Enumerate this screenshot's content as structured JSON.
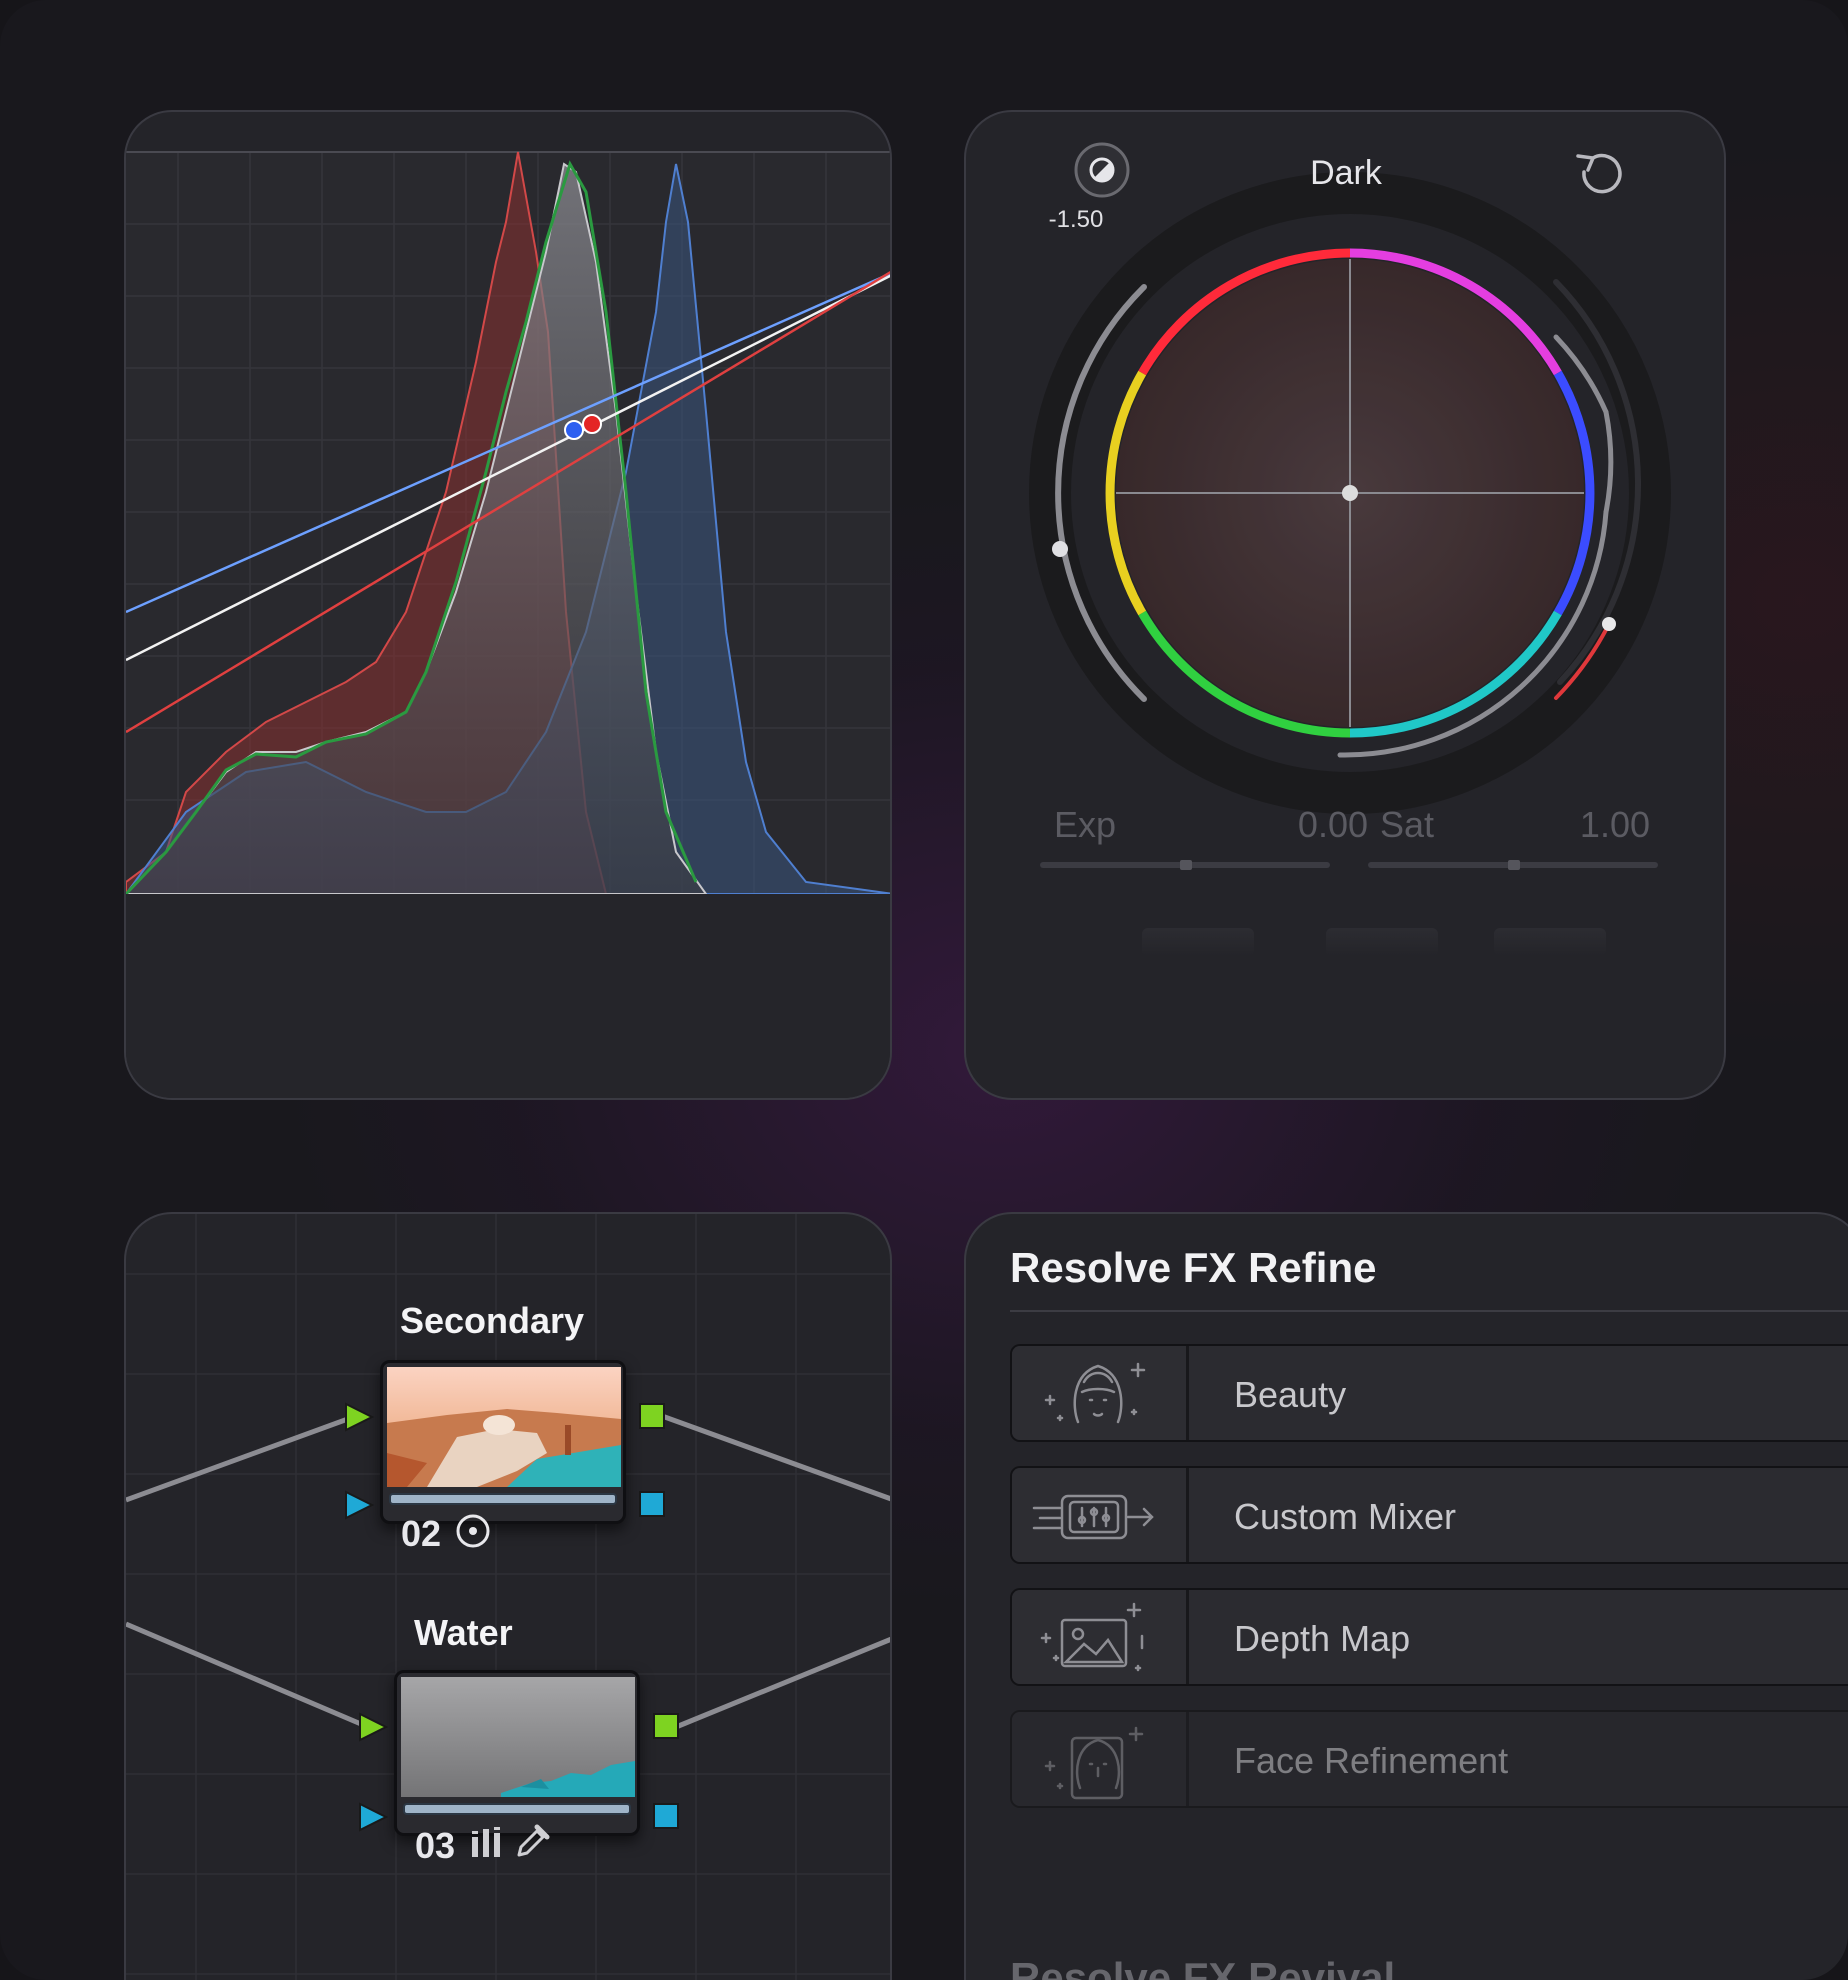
{
  "wheel": {
    "title": "Dark",
    "value": "-1.50",
    "exp_label": "Exp",
    "exp_value": "0.00",
    "sat_label": "Sat",
    "sat_value": "1.00",
    "colors": {
      "background": "#242429",
      "accent_red": "#e0383b"
    }
  },
  "scope": {
    "curves": [
      "red",
      "green",
      "blue",
      "luma"
    ],
    "colors": {
      "red": "#d63a3a",
      "green": "#2fa84a",
      "blue": "#4f8ef0",
      "white": "#ffffff"
    }
  },
  "nodes": [
    {
      "title": "Secondary",
      "number": "02",
      "icons": [
        "target-icon"
      ]
    },
    {
      "title": "Water",
      "number": "03",
      "icons": [
        "bars-icon",
        "eyedropper-icon"
      ]
    }
  ],
  "fx": {
    "section_title": "Resolve FX Refine",
    "items": [
      {
        "label": "Beauty",
        "icon": "face-sparkle-icon"
      },
      {
        "label": "Custom Mixer",
        "icon": "mixer-icon"
      },
      {
        "label": "Depth Map",
        "icon": "depth-map-icon"
      },
      {
        "label": "Face Refinement",
        "icon": "face-refine-icon"
      }
    ],
    "next_section_title": "Resolve FX Revival"
  }
}
